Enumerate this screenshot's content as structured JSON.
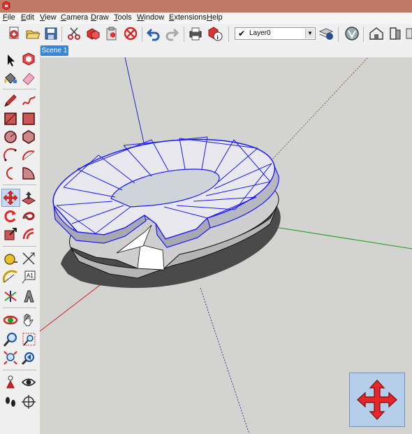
{
  "window": {
    "app_icon": "sketchup-logo-icon"
  },
  "menu": [
    {
      "label": "File",
      "accel": "F",
      "rest": "ile"
    },
    {
      "label": "Edit",
      "accel": "E",
      "rest": "dit"
    },
    {
      "label": "View",
      "accel": "V",
      "rest": "iew"
    },
    {
      "label": "Camera",
      "accel": "C",
      "rest": "amera"
    },
    {
      "label": "Draw",
      "accel": "D",
      "rest": "raw"
    },
    {
      "label": "Tools",
      "accel": "T",
      "rest": "ools"
    },
    {
      "label": "Window",
      "accel": "W",
      "rest": "indow"
    },
    {
      "label": "Extensions",
      "accel": "E",
      "rest": "xtensions"
    },
    {
      "label": "Help",
      "accel": "H",
      "rest": "elp"
    }
  ],
  "toolbar": {
    "buttons": [
      "new-icon",
      "open-icon",
      "save-icon",
      "cut-icon",
      "copy-icon",
      "paste-icon",
      "erase-icon",
      "undo-icon",
      "redo-icon",
      "print-icon",
      "model-info-icon"
    ],
    "layer": {
      "checked": true,
      "check_glyph": "✔",
      "current": "Layer0"
    },
    "right_buttons": [
      "layer-manager-icon",
      "style-icon",
      "warehouse-icon",
      "extension-warehouse-icon"
    ]
  },
  "scenes": {
    "tabs": [
      "Scene 1"
    ]
  },
  "tools": [
    "select-icon",
    "component-icon",
    "paint-bucket-icon",
    "eraser-icon",
    "pencil-icon",
    "freehand-icon",
    "rectangle-icon",
    "rotated-rectangle-icon",
    "circle-icon",
    "polygon-icon",
    "arc-icon",
    "two-point-arc-icon",
    "three-point-arc-icon",
    "pie-icon",
    "move-icon",
    "push-pull-icon",
    "rotate-icon",
    "follow-me-icon",
    "scale-icon",
    "offset-icon",
    "tape-measure-icon",
    "dimension-icon",
    "protractor-icon",
    "text-icon",
    "axes-icon",
    "3d-text-icon",
    "orbit-icon",
    "pan-icon",
    "zoom-icon",
    "zoom-window-icon",
    "zoom-extents-icon",
    "previous-view-icon",
    "position-camera-icon",
    "look-around-icon",
    "walk-icon",
    "section-plane-icon"
  ],
  "colors": {
    "selection": "#1a1aff",
    "axis_red": "#d02020",
    "axis_green": "#1a9a1a",
    "axis_blue": "#2020c0",
    "sky": "#d7d7d2",
    "ground": "#bcbcb6",
    "active_tool_bg": "#c8daf0"
  },
  "viewport": {
    "active_tool": "move-icon",
    "nav_widget": "move-arrows-icon"
  }
}
